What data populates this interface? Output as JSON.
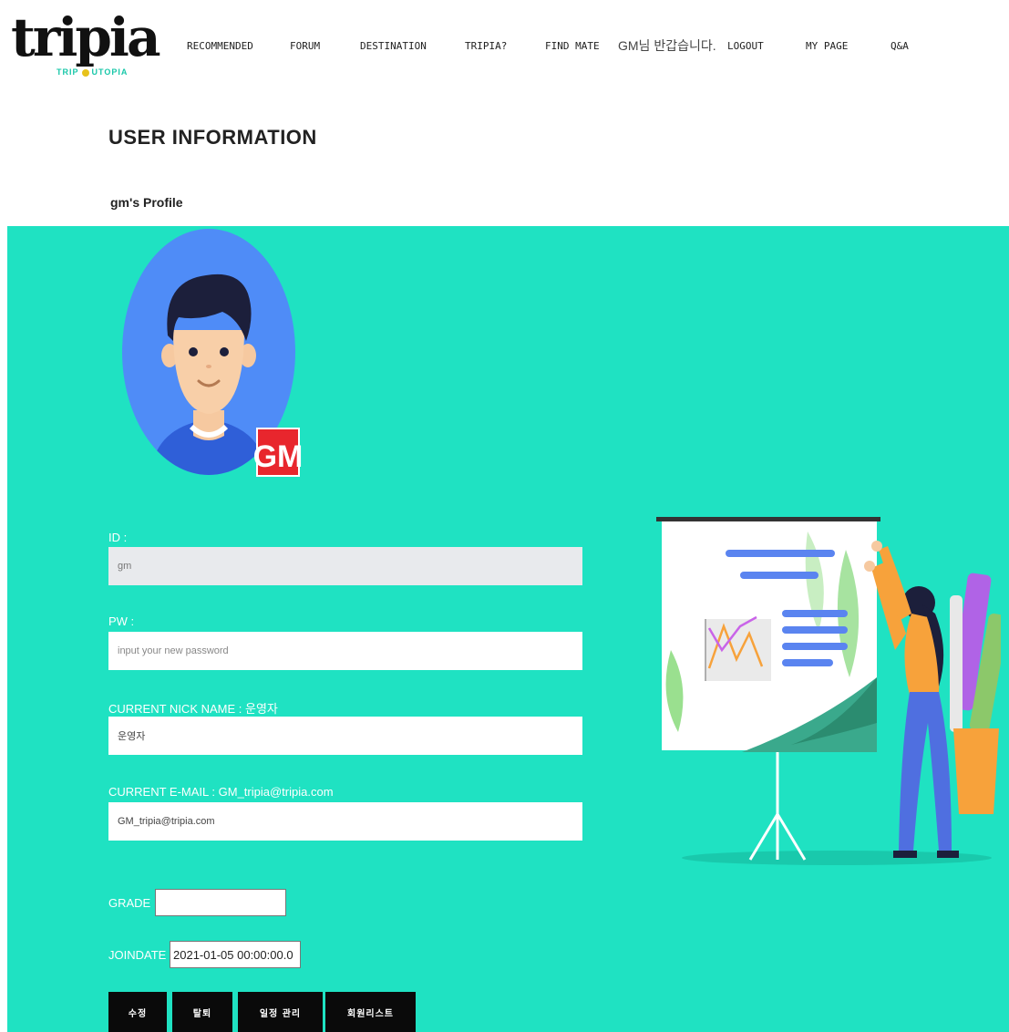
{
  "header": {
    "logo": {
      "word": "tripia",
      "sub_left": "TRIP",
      "sub_right": "UTOPIA"
    },
    "nav": [
      "RECOMMENDED",
      "FORUM",
      "DESTINATION",
      "TRIPIA?",
      "FIND MATE"
    ],
    "greeting": "GM님 반갑습니다.",
    "user_nav": [
      "LOGOUT",
      "MY PAGE",
      "Q&A"
    ]
  },
  "page": {
    "title": "USER INFORMATION",
    "profile_title": "gm's Profile",
    "avatar_badge": "GM"
  },
  "form": {
    "id_label": "ID :",
    "id_value": "gm",
    "pw_label": "PW :",
    "pw_placeholder": "input your new password",
    "nick_label": "CURRENT NICK NAME : 운영자",
    "nick_value": "운영자",
    "email_label": "CURRENT E-MAIL : GM_tripia@tripia.com",
    "email_value": "GM_tripia@tripia.com",
    "grade_label": "GRADE :",
    "grade_value": "",
    "joindate_label": "JOINDATE :",
    "joindate_value": "2021-01-05 00:00:00.0"
  },
  "buttons": {
    "edit": "수정",
    "withdraw": "탈퇴",
    "schedule": "일정 관리",
    "member_list": "회원리스트"
  },
  "colors": {
    "panel_bg": "#1fe2c2",
    "avatar_circle": "#4f8cf7",
    "badge_bg": "#e8262d",
    "button_bg": "#0a0a0a"
  }
}
